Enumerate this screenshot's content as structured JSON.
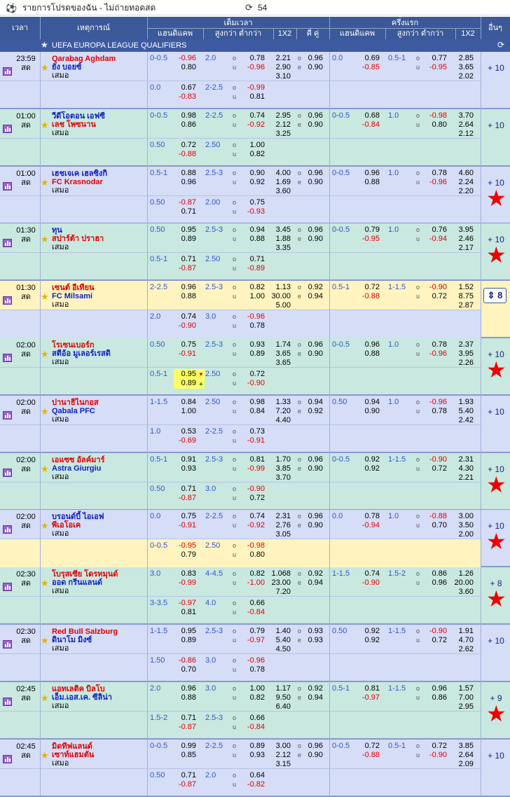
{
  "topbar": {
    "title": "รายการโปรดของฉัน - ไม่ถ่ายทอดสด",
    "count": "54"
  },
  "header": {
    "time": "เวลา",
    "event": "เหตุการณ์",
    "fulltime": "เต็มเวลา",
    "firsthalf": "ครึ่งแรก",
    "more": "อื่นๆ",
    "handicap": "แฮนดิแคพ",
    "overunder": "สูงกว่า ต่ำกว่า",
    "x12": "1X2",
    "oddeven": "คี่ คู่"
  },
  "league": {
    "name": "UEFA EUROPA LEAGUE QUALIFIERS"
  },
  "labels": {
    "o": "o",
    "u": "u",
    "e": "e",
    "live": "สด",
    "draw": "เสมอ"
  },
  "matches": [
    {
      "time": "23:59",
      "home": "Qarabag Aghdam",
      "away": "ยัง บอยซ์",
      "home_red": true,
      "away_red": false,
      "more": "+ 10",
      "star": false,
      "r1": {
        "hcl": "0-0.5",
        "h1": "-0.96",
        "h2": "0.80",
        "oul": "2.0",
        "o1": "0.78",
        "o2": "-0.96",
        "x1": "2.21",
        "x2": "2.90",
        "x3": "3.10",
        "e1": "0.96",
        "e2": "0.90",
        "fhcl": "0.0",
        "fh1": "0.69",
        "fh2": "-0.85",
        "foul": "0.5-1",
        "fo1": "0.77",
        "fo2": "-0.95",
        "fx1": "2.85",
        "fx2": "3.65",
        "fx3": "2.02"
      },
      "r2": {
        "hcl": "0.0",
        "h1": "0.67",
        "h2": "-0.83",
        "oul": "2-2.5",
        "o1": "-0.99",
        "o2": "0.81"
      }
    },
    {
      "time": "01:00",
      "home": "วีดีโอตอน เอฟซี",
      "away": "เลช โพซนาน",
      "home_red": false,
      "away_red": true,
      "more": "+ 10",
      "star": false,
      "r1": {
        "hcl": "0-0.5",
        "h1": "0.98",
        "h2": "0.86",
        "oul": "2-2.5",
        "o1": "0.74",
        "o2": "-0.92",
        "x1": "2.95",
        "x2": "2.12",
        "x3": "3.25",
        "e1": "0.96",
        "e2": "0.90",
        "fhcl": "0-0.5",
        "fh1": "0.68",
        "fh2": "-0.84",
        "foul": "1.0",
        "fo1": "-0.98",
        "fo2": "0.80",
        "fx1": "3.70",
        "fx2": "2.64",
        "fx3": "2.12"
      },
      "r2": {
        "hcl": "0.50",
        "h1": "0.72",
        "h2": "-0.88",
        "oul": "2.50",
        "o1": "1.00",
        "o2": "0.82"
      }
    },
    {
      "time": "01:00",
      "home": "เฮชเจเค เฮลซิงกิ",
      "away": "FC Krasnodar",
      "home_red": false,
      "away_red": true,
      "more": "+ 10",
      "star": true,
      "r1": {
        "hcl": "0.5-1",
        "h1": "0.88",
        "h2": "0.96",
        "oul": "2.5-3",
        "o1": "0.90",
        "o2": "0.92",
        "x1": "4.00",
        "x2": "1.69",
        "x3": "3.60",
        "e1": "0.96",
        "e2": "0.90",
        "fhcl": "0-0.5",
        "fh1": "0.96",
        "fh2": "0.88",
        "foul": "1.0",
        "fo1": "0.78",
        "fo2": "-0.96",
        "fx1": "4.60",
        "fx2": "2.24",
        "fx3": "2.20"
      },
      "r2": {
        "hcl": "0.50",
        "h1": "-0.87",
        "h2": "0.71",
        "oul": "2.00",
        "o1": "0.75",
        "o2": "-0.93"
      }
    },
    {
      "time": "01:30",
      "home": "ทุน",
      "away": "สปาร์ต้า ปราฮา",
      "home_red": false,
      "away_red": true,
      "more": "+ 10",
      "star": true,
      "r1": {
        "hcl": "0.50",
        "h1": "0.95",
        "h2": "0.89",
        "oul": "2.5-3",
        "o1": "0.94",
        "o2": "0.88",
        "x1": "3.45",
        "x2": "1.88",
        "x3": "3.35",
        "e1": "0.96",
        "e2": "0.90",
        "fhcl": "0-0.5",
        "fh1": "0.79",
        "fh2": "-0.95",
        "foul": "1.0",
        "fo1": "0.76",
        "fo2": "-0.94",
        "fx1": "3.95",
        "fx2": "2.46",
        "fx3": "2.17"
      },
      "r2": {
        "hcl": "0.5-1",
        "h1": "0.71",
        "h2": "-0.87",
        "oul": "2.50",
        "o1": "0.71",
        "o2": "-0.89"
      }
    },
    {
      "time": "01:30",
      "home": "เซนต์ อีเทียน",
      "away": "FC Milsami",
      "home_red": true,
      "away_red": false,
      "more": "8",
      "star": false,
      "spin": true,
      "highlight": true,
      "r1": {
        "hcl": "2-2.5",
        "h1": "0.96",
        "h2": "0.88",
        "oul": "2.5-3",
        "o1": "0.82",
        "o2": "1.00",
        "x1": "1.13",
        "x2": "30.00",
        "x3": "5.00",
        "e1": "0.92",
        "e2": "0.94",
        "fhcl": "0.5-1",
        "fh1": "0.72",
        "fh2": "-0.88",
        "foul": "1-1.5",
        "fo1": "-0.90",
        "fo2": "0.72",
        "fx1": "1.52",
        "fx2": "8.75",
        "fx3": "2.87"
      },
      "r2": {
        "hcl": "2.0",
        "h1": "0.74",
        "h2": "-0.90",
        "oul": "3.0",
        "o1": "-0.96",
        "o2": "0.78"
      }
    },
    {
      "time": "02:00",
      "home": "โรเซนเบอร์ก",
      "away": "สตีอ้อ มูเลอร์เรสดิ",
      "home_red": true,
      "away_red": false,
      "more": "+ 10",
      "star": true,
      "r1": {
        "hcl": "0.50",
        "h1": "0.75",
        "h2": "-0.91",
        "oul": "2.5-3",
        "o1": "0.93",
        "o2": "0.89",
        "x1": "1.74",
        "x2": "3.65",
        "x3": "3.65",
        "e1": "0.96",
        "e2": "0.90",
        "fhcl": "0-0.5",
        "fh1": "0.96",
        "fh2": "0.88",
        "foul": "1.0",
        "fo1": "0.78",
        "fo2": "-0.96",
        "fx1": "2.37",
        "fx2": "3.95",
        "fx3": "2.26"
      },
      "r2": {
        "hcl": "0.5-1",
        "h1": "0.95",
        "h2": "0.89",
        "oul": "2.50",
        "o1": "0.72",
        "o2": "-0.90",
        "hi": true
      }
    },
    {
      "time": "02:00",
      "home": "ปานาธิไนกอส",
      "away": "Qabala PFC",
      "home_red": true,
      "away_red": false,
      "more": "+ 10",
      "star": false,
      "r1": {
        "hcl": "1-1.5",
        "h1": "0.84",
        "h2": "1.00",
        "oul": "2.50",
        "o1": "0.98",
        "o2": "0.84",
        "x1": "1.33",
        "x2": "7.20",
        "x3": "4.40",
        "e1": "0.94",
        "e2": "0.92",
        "fhcl": "0.50",
        "fh1": "0.94",
        "fh2": "0.90",
        "foul": "1.0",
        "fo1": "-0.96",
        "fo2": "0.78",
        "fx1": "1.93",
        "fx2": "5.40",
        "fx3": "2.42"
      },
      "r2": {
        "hcl": "1.0",
        "h1": "0.53",
        "h2": "-0.69",
        "oul": "2-2.5",
        "o1": "0.73",
        "o2": "-0.91"
      }
    },
    {
      "time": "02:00",
      "home": "เอแซซ อัลค์มาร์",
      "away": "Astra Giurgiu",
      "home_red": true,
      "away_red": false,
      "more": "+ 10",
      "star": true,
      "r1": {
        "hcl": "0.5-1",
        "h1": "0.91",
        "h2": "0.93",
        "oul": "2.5-3",
        "o1": "0.81",
        "o2": "-0.99",
        "x1": "1.70",
        "x2": "3.85",
        "x3": "3.70",
        "e1": "0.96",
        "e2": "0.90",
        "fhcl": "0-0.5",
        "fh1": "0.92",
        "fh2": "0.92",
        "foul": "1-1.5",
        "fo1": "-0.90",
        "fo2": "0.72",
        "fx1": "2.31",
        "fx2": "4.30",
        "fx3": "2.21"
      },
      "r2": {
        "hcl": "0.50",
        "h1": "0.71",
        "h2": "-0.87",
        "oul": "3.0",
        "o1": "-0.90",
        "o2": "0.72"
      }
    },
    {
      "time": "02:00",
      "home": "บรอนด์บี้ ไอเอฟ",
      "away": "พีเอโอเค",
      "home_red": false,
      "away_red": true,
      "more": "+ 10",
      "star": true,
      "highlight2": true,
      "r1": {
        "hcl": "0.0",
        "h1": "0.75",
        "h2": "-0.91",
        "oul": "2-2.5",
        "o1": "0.74",
        "o2": "-0.92",
        "x1": "2.31",
        "x2": "2.76",
        "x3": "3.05",
        "e1": "0.96",
        "e2": "0.90",
        "fhcl": "0.0",
        "fh1": "0.78",
        "fh2": "-0.94",
        "foul": "1.0",
        "fo1": "-0.88",
        "fo2": "0.70",
        "fx1": "3.00",
        "fx2": "3.50",
        "fx3": "2.00"
      },
      "r2": {
        "hcl": "0-0.5",
        "h1": "-0.95",
        "h2": "0.79",
        "oul": "2.50",
        "o1": "-0.98",
        "o2": "0.80"
      }
    },
    {
      "time": "02:30",
      "home": "โบรุสเซีย โดรทมุนด์",
      "away": "ออด กรีนแลนด์",
      "home_red": true,
      "away_red": false,
      "more": "+ 8",
      "star": true,
      "r1": {
        "hcl": "3.0",
        "h1": "0.83",
        "h2": "-0.99",
        "oul": "4-4.5",
        "o1": "0.82",
        "o2": "-1.00",
        "x1": "1.068",
        "x2": "23.00",
        "x3": "7.20",
        "e1": "0.92",
        "e2": "0.94",
        "fhcl": "1-1.5",
        "fh1": "0.74",
        "fh2": "-0.90",
        "foul": "1.5-2",
        "fo1": "0.86",
        "fo2": "0.96",
        "fx1": "1.26",
        "fx2": "20.00",
        "fx3": "3.60"
      },
      "r2": {
        "hcl": "3-3.5",
        "h1": "-0.97",
        "h2": "0.81",
        "oul": "4.0",
        "o1": "0.66",
        "o2": "-0.84"
      }
    },
    {
      "time": "02:30",
      "home": "Red Bull Salzburg",
      "away": "ดินาโม มิงซ์",
      "home_red": true,
      "away_red": false,
      "more": "+ 10",
      "star": false,
      "r1": {
        "hcl": "1-1.5",
        "h1": "0.95",
        "h2": "0.89",
        "oul": "2.5-3",
        "o1": "0.79",
        "o2": "-0.97",
        "x1": "1.40",
        "x2": "5.40",
        "x3": "4.50",
        "e1": "0.93",
        "e2": "0.93",
        "fhcl": "0.50",
        "fh1": "0.92",
        "fh2": "0.92",
        "foul": "1-1.5",
        "fo1": "-0.90",
        "fo2": "0.72",
        "fx1": "1.91",
        "fx2": "4.70",
        "fx3": "2.62"
      },
      "r2": {
        "hcl": "1.50",
        "h1": "-0.86",
        "h2": "0.70",
        "oul": "3.0",
        "o1": "-0.96",
        "o2": "0.78"
      }
    },
    {
      "time": "02:45",
      "home": "แอทเลติค บิลโบ",
      "away": "เอ็ม.เอส.เค. ซีลิน่า",
      "home_red": true,
      "away_red": false,
      "more": "+ 9",
      "star": true,
      "r1": {
        "hcl": "2.0",
        "h1": "0.96",
        "h2": "0.88",
        "oul": "3.0",
        "o1": "1.00",
        "o2": "0.82",
        "x1": "1.17",
        "x2": "9.50",
        "x3": "6.40",
        "e1": "0.92",
        "e2": "0.94",
        "fhcl": "0.5-1",
        "fh1": "0.81",
        "fh2": "-0.97",
        "foul": "1-1.5",
        "fo1": "0.96",
        "fo2": "0.86",
        "fx1": "1.57",
        "fx2": "7.00",
        "fx3": "2.95"
      },
      "r2": {
        "hcl": "1.5-2",
        "h1": "0.71",
        "h2": "-0.87",
        "oul": "2.5-3",
        "o1": "0.66",
        "o2": "-0.84"
      }
    },
    {
      "time": "02:45",
      "home": "มิดทีฟแลนด์",
      "away": "เซาท์แฮมตัน",
      "home_red": true,
      "away_red": true,
      "more": "+ 10",
      "star": false,
      "r1": {
        "hcl": "0-0.5",
        "h1": "0.99",
        "h2": "0.85",
        "oul": "2-2.5",
        "o1": "0.89",
        "o2": "0.93",
        "x1": "3.00",
        "x2": "2.12",
        "x3": "3.15",
        "e1": "0.96",
        "e2": "0.90",
        "fhcl": "0-0.5",
        "fh1": "0.72",
        "fh2": "-0.88",
        "foul": "0.5-1",
        "fo1": "0.72",
        "fo2": "-0.90",
        "fx1": "3.85",
        "fx2": "2.64",
        "fx3": "2.09"
      },
      "r2": {
        "hcl": "0.50",
        "h1": "0.71",
        "h2": "-0.87",
        "oul": "2.0",
        "o1": "0.64",
        "o2": "-0.82"
      }
    }
  ],
  "colors": {
    "header": "#3b5998",
    "rowA": "#d5ddf7",
    "rowB": "#c9e8e0",
    "yellow": "#fff4c0",
    "red": "#e00000",
    "blue": "#1020c0"
  }
}
